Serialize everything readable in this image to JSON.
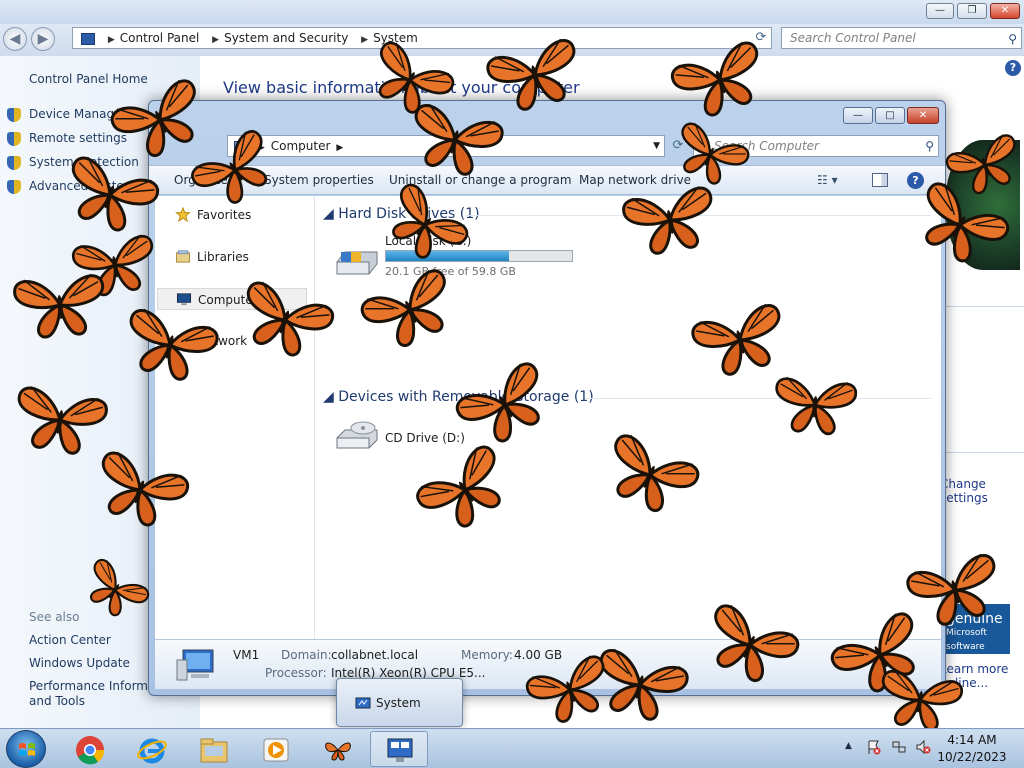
{
  "control_panel": {
    "address": [
      "Control Panel",
      "System and Security",
      "System"
    ],
    "search_placeholder": "Search Control Panel",
    "home_link": "Control Panel Home",
    "tasks": [
      "Device Manager",
      "Remote settings",
      "System protection",
      "Advanced system settings"
    ],
    "heading": "View basic information about your computer",
    "see_also_label": "See also",
    "see_also": [
      "Action Center",
      "Windows Update",
      "Performance Information and Tools"
    ],
    "change_settings_link": "Change settings",
    "genuine_title": "genuine",
    "genuine_sub": "Microsoft software",
    "more_online_link": "Learn more online..."
  },
  "explorer": {
    "address": [
      "Computer"
    ],
    "search_placeholder": "Search Computer",
    "commands": [
      "Organize",
      "System properties",
      "Uninstall or change a program",
      "Map network drive"
    ],
    "nav": [
      "Favorites",
      "Libraries",
      "Computer",
      "Network"
    ],
    "selected_nav": "Computer",
    "groups": {
      "hard_disks": "Hard Disk Drives (1)",
      "removable": "Devices with Removable Storage (1)"
    },
    "drives": [
      {
        "label": "Local Disk (C:)",
        "free_text": "20.1 GB free of 59.8 GB",
        "used_fraction": 0.66
      },
      {
        "label": "CD Drive (D:)"
      }
    ],
    "details": {
      "name": "VM1",
      "domain_label": "Domain:",
      "domain": "collabnet.local",
      "memory_label": "Memory:",
      "memory": "4.00 GB",
      "processor_label": "Processor:",
      "processor": "Intel(R) Xeon(R) CPU E5..."
    }
  },
  "taskbar": {
    "apps": [
      "chrome-icon",
      "internet-explorer-icon",
      "windows-explorer-icon",
      "media-player-icon",
      "butterfly-app-icon",
      "system-window-icon"
    ],
    "popup_label": "System",
    "time": "4:14 AM",
    "date": "10/22/2023"
  },
  "colors": {
    "accent": "#1e3a8a",
    "butterfly_orange": "#e8742a",
    "butterfly_black": "#1a1208"
  }
}
